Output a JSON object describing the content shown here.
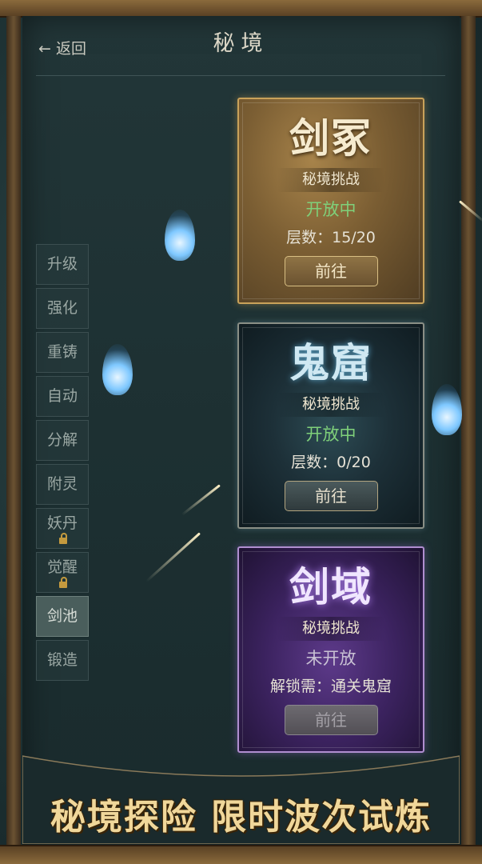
{
  "header": {
    "back_label": "← 返回",
    "title": "秘境"
  },
  "menu": {
    "items": [
      {
        "label": "升级",
        "locked": false,
        "active": false
      },
      {
        "label": "强化",
        "locked": false,
        "active": false
      },
      {
        "label": "重铸",
        "locked": false,
        "active": false
      },
      {
        "label": "自动",
        "locked": false,
        "active": false
      },
      {
        "label": "分解",
        "locked": false,
        "active": false
      },
      {
        "label": "附灵",
        "locked": false,
        "active": false
      },
      {
        "label": "妖丹",
        "locked": true,
        "active": false
      },
      {
        "label": "觉醒",
        "locked": true,
        "active": false
      },
      {
        "label": "剑池",
        "locked": false,
        "active": true
      },
      {
        "label": "锻造",
        "locked": false,
        "active": false
      }
    ]
  },
  "cards": [
    {
      "name": "剑冢",
      "subtitle": "秘境挑战",
      "status": "开放中",
      "info": "层数：15/20",
      "button": "前往",
      "theme": "gold"
    },
    {
      "name": "鬼窟",
      "subtitle": "秘境挑战",
      "status": "开放中",
      "info": "层数：0/20",
      "button": "前往",
      "theme": "dark"
    },
    {
      "name": "剑域",
      "subtitle": "秘境挑战",
      "status": "未开放",
      "info": "解锁需：通关鬼窟",
      "button": "前往",
      "theme": "purple"
    }
  ],
  "slogan": "秘境探险 限时波次试炼",
  "colors": {
    "panel": "#1c2f31",
    "gold": "#c9a25a",
    "open_green": "#7fd07a",
    "slogan": "#f0d79a"
  }
}
